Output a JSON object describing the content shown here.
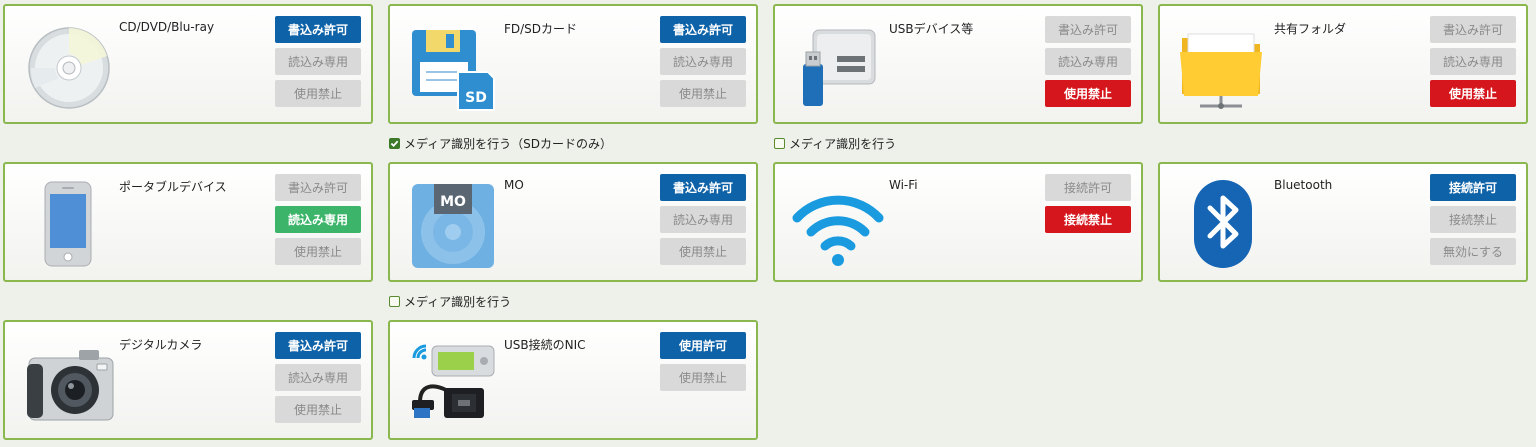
{
  "devices": {
    "cd": {
      "label": "CD/DVD/Blu-ray",
      "buttons": [
        "書込み許可",
        "読込み専用",
        "使用禁止"
      ]
    },
    "fd": {
      "label": "FD/SDカード",
      "buttons": [
        "書込み許可",
        "読込み専用",
        "使用禁止"
      ],
      "icon_text": "SD"
    },
    "usb": {
      "label": "USBデバイス等",
      "buttons": [
        "書込み許可",
        "読込み専用",
        "使用禁止"
      ]
    },
    "share": {
      "label": "共有フォルダ",
      "buttons": [
        "書込み許可",
        "読込み専用",
        "使用禁止"
      ]
    },
    "portable": {
      "label": "ポータブルデバイス",
      "buttons": [
        "書込み許可",
        "読込み専用",
        "使用禁止"
      ]
    },
    "mo": {
      "label": "MO",
      "buttons": [
        "書込み許可",
        "読込み専用",
        "使用禁止"
      ],
      "icon_text": "MO"
    },
    "wifi": {
      "label": "Wi-Fi",
      "buttons": [
        "接続許可",
        "接続禁止"
      ]
    },
    "bluetooth": {
      "label": "Bluetooth",
      "buttons": [
        "接続許可",
        "接続禁止",
        "無効にする"
      ]
    },
    "camera": {
      "label": "デジタルカメラ",
      "buttons": [
        "書込み許可",
        "読込み専用",
        "使用禁止"
      ]
    },
    "nic": {
      "label": "USB接続のNIC",
      "buttons": [
        "使用許可",
        "使用禁止"
      ]
    }
  },
  "options": {
    "fd_media": {
      "label": "メディア識別を行う（SDカードのみ）",
      "checked": true
    },
    "usb_media": {
      "label": "メディア識別を行う",
      "checked": false
    },
    "mo_media": {
      "label": "メディア識別を行う",
      "checked": false
    }
  },
  "colors": {
    "blue": "#0e62a8",
    "red": "#d5161c",
    "green": "#3cb46a",
    "off": "#d9d9d9",
    "border": "#8ab84e"
  }
}
